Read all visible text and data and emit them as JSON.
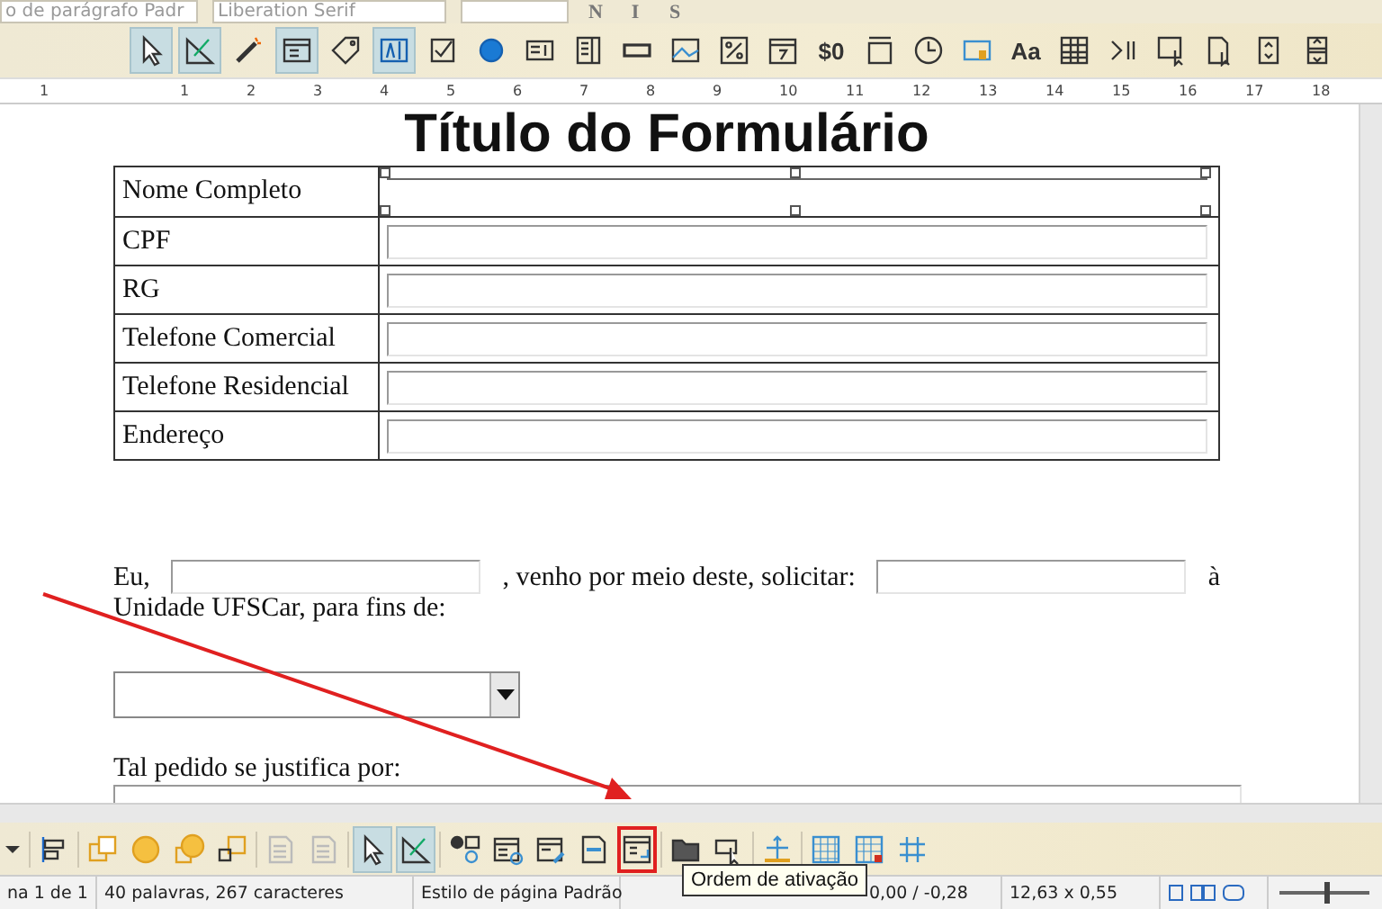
{
  "format_bar": {
    "paragraph_style": "o de parágrafo Padr",
    "font_name": "Liberation Serif",
    "format_buttons": [
      "N",
      "I",
      "S"
    ]
  },
  "form_controls_toolbar": [
    {
      "on": true
    },
    {
      "on": true
    },
    {
      "on": false
    },
    {
      "on": true
    },
    {
      "on": false
    },
    {
      "on": true
    },
    {
      "on": false
    },
    {
      "on": false
    },
    {
      "on": false
    },
    {
      "on": false
    },
    {
      "on": false
    },
    {
      "on": false
    },
    {
      "on": false
    },
    {
      "on": false
    },
    {
      "on": false,
      "label": "$0"
    },
    {
      "on": false
    },
    {
      "on": false
    },
    {
      "on": false
    },
    {
      "on": false,
      "label": "Aa"
    },
    {
      "on": false
    },
    {
      "on": false
    },
    {
      "on": false
    },
    {
      "on": false
    },
    {
      "on": false
    },
    {
      "on": false
    }
  ],
  "ruler": {
    "labels": [
      "1",
      "1",
      "2",
      "3",
      "4",
      "5",
      "6",
      "7",
      "8",
      "9",
      "10",
      "11",
      "12",
      "13",
      "14",
      "15",
      "16",
      "17",
      "18"
    ]
  },
  "document": {
    "title": "Título do Formulário",
    "table": {
      "rows": [
        {
          "label": "Nome Completo",
          "selected": true
        },
        {
          "label": "CPF",
          "selected": false
        },
        {
          "label": "RG",
          "selected": false
        },
        {
          "label": "Telefone Comercial",
          "selected": false
        },
        {
          "label": "Telefone Residencial",
          "selected": false
        },
        {
          "label": "Endereço",
          "selected": false
        }
      ]
    },
    "paragraph": [
      {
        "kind": "text",
        "text": "Eu,"
      },
      {
        "kind": "field"
      },
      {
        "kind": "text",
        "text": ", venho por meio deste, solicitar:"
      },
      {
        "kind": "field"
      },
      {
        "kind": "text",
        "text": "à"
      }
    ],
    "paragraph_line2": "Unidade UFSCar, para fins de:",
    "justification_label": "Tal pedido se justifica por:"
  },
  "form_design_toolbar": [
    {
      "on": false
    },
    {
      "on": false
    },
    {
      "on": false
    },
    {
      "on": false
    },
    {
      "on": false
    },
    {
      "on": false
    },
    {
      "on": false
    },
    {
      "on": false
    },
    {
      "on": true
    },
    {
      "on": true
    },
    {
      "on": false
    },
    {
      "on": false
    },
    {
      "on": false
    },
    {
      "on": false
    },
    {
      "on": false,
      "highlighted": true
    },
    {
      "on": false
    },
    {
      "on": false
    },
    {
      "on": false
    },
    {
      "on": false
    },
    {
      "on": false
    },
    {
      "on": false
    }
  ],
  "status_bar": {
    "page": "na 1 de 1",
    "words": "40 palavras, 267 caracteres",
    "page_style": "Estilo de página Padrão",
    "position": "0,00 / -0,28",
    "size": "12,63 x 0,55",
    "zoom_slider": {
      "level": 0.5
    }
  },
  "tooltip": "Ordem de ativação"
}
